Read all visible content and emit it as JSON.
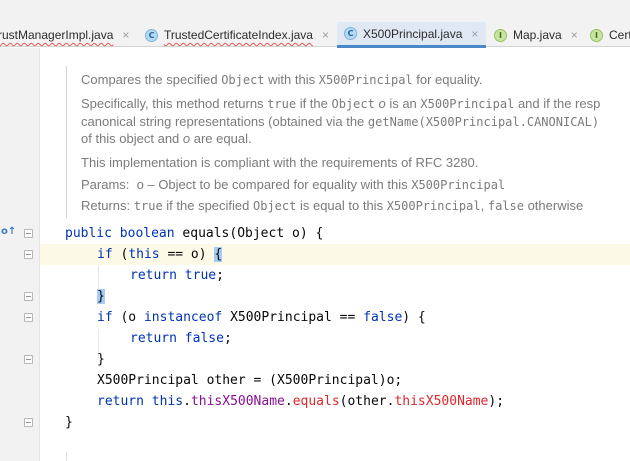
{
  "tabs": [
    {
      "label": "rustManagerImpl.java",
      "icon": "none",
      "active": false,
      "error": true
    },
    {
      "label": "TrustedCertificateIndex.java",
      "icon": "class-icon",
      "active": false,
      "error": true
    },
    {
      "label": "X500Principal.java",
      "icon": "class-icon",
      "active": true,
      "error": false
    },
    {
      "label": "Map.java",
      "icon": "interface-icon",
      "active": false,
      "error": false
    },
    {
      "label": "Cert",
      "icon": "interface-icon",
      "active": false,
      "error": false
    }
  ],
  "tab_close_glyph": "×",
  "icon_letters": {
    "class": "C",
    "interface": "I"
  },
  "doc": {
    "line1": {
      "a": "Compares the specified ",
      "b": "Object",
      "c": " with this ",
      "d": "X500Principal",
      "e": " for equality."
    },
    "line2": {
      "a": "Specifically, this method returns ",
      "b": "true",
      "c": " if the ",
      "d": "Object",
      "e": " ",
      "f": "o",
      "g": " is an ",
      "h": "X500Principal",
      "i": " and if the resp"
    },
    "line3": {
      "a": "canonical string representations (obtained via the ",
      "b": "getName(X500Principal.CANONICAL)"
    },
    "line4": {
      "a": "of this object and ",
      "b": "o",
      "c": " are equal."
    },
    "line5": "This implementation is compliant with the requirements of RFC 3280.",
    "params": {
      "label": "Params:",
      "a": "o – Object to be compared for equality with this ",
      "b": "X500Principal"
    },
    "returns": {
      "label": "Returns:",
      "a": "true",
      "b": " if the specified ",
      "c": "Object",
      "d": " is equal to this ",
      "e": "X500Principal",
      "f": ", ",
      "g": "false",
      "h": " otherwise"
    }
  },
  "code": {
    "l1": {
      "kw1": "public",
      "sp1": " ",
      "kw2": "boolean",
      "rest": " equals(Object o) {"
    },
    "l2": {
      "kw": "if",
      "mid": " (",
      "kw2": "this",
      "rest": " == o) ",
      "brace": "{"
    },
    "l3": {
      "kw": "return",
      "sp": " ",
      "kw2": "true",
      "rest": ";"
    },
    "l4": {
      "brace": "}"
    },
    "l5": {
      "kw": "if",
      "a": " (o ",
      "kw2": "instanceof",
      "b": " X500Principal == ",
      "kw3": "false",
      "c": ") {"
    },
    "l6": {
      "kw": "return",
      "sp": " ",
      "kw2": "false",
      "rest": ";"
    },
    "l7": {
      "brace": "}"
    },
    "l8": {
      "text": "X500Principal other = (X500Principal)o;"
    },
    "l9": {
      "kw": "return",
      "sp": " ",
      "kw2": "this",
      "dot1": ".",
      "fld1": "thisX500Name",
      "dot2": ".",
      "mth": "equals",
      "open": "(other.",
      "fld2": "thisX500Name",
      "close": ");"
    },
    "l10": {
      "brace": "}"
    }
  },
  "gutter": {
    "override_icon": "o↑"
  },
  "colors": {
    "keyword": "#0033b3",
    "field": "#871094",
    "method": "#00627a",
    "red": "#e0262c",
    "doc_text": "#7b7b7b",
    "active_tab": "#4a88c7"
  }
}
